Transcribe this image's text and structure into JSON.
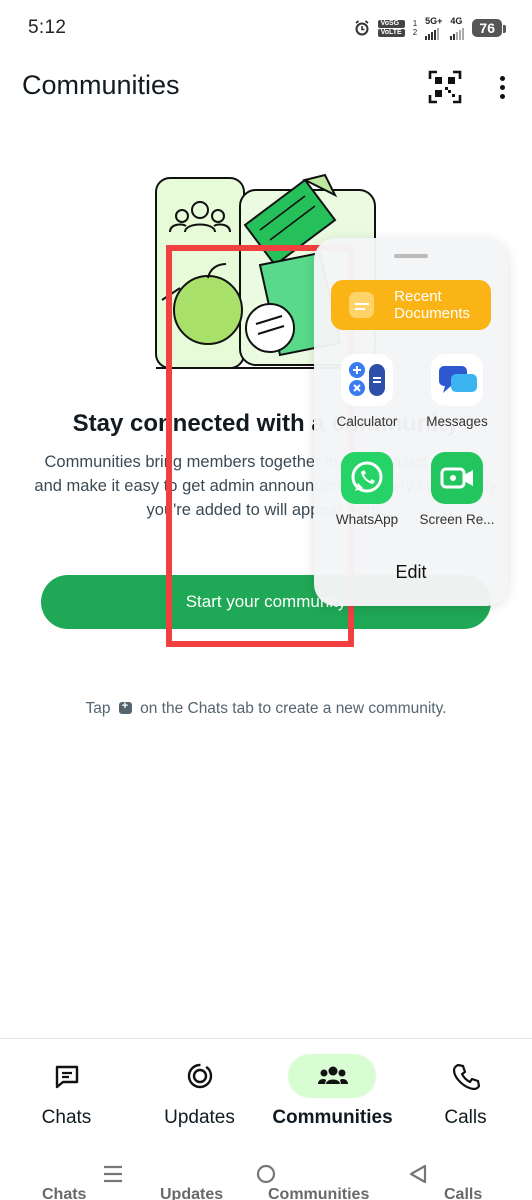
{
  "status_bar": {
    "time": "5:12",
    "volte_top": "VoSG",
    "volte_bottom": "VoLTE",
    "sim1": "1",
    "sim2": "2",
    "net1": "5G+",
    "net2": "4G",
    "battery": "76"
  },
  "header": {
    "title": "Communities",
    "qr_icon": "qr-code-icon",
    "more_icon": "more-vertical-icon"
  },
  "main": {
    "headline": "Stay connected with a community",
    "description": "Communities bring members together in topic-based groups, and make it easy to get admin announcements. Any community you're added to will appear here.",
    "start_button": "Start your community",
    "hint_before": "Tap",
    "hint_after": "on the Chats tab to create a new community."
  },
  "side_panel": {
    "recent_documents": "Recent Documents",
    "apps": [
      {
        "label": "Calculator",
        "icon": "calculator-icon"
      },
      {
        "label": "Messages",
        "icon": "messages-icon"
      },
      {
        "label": "WhatsApp",
        "icon": "whatsapp-icon"
      },
      {
        "label": "Screen Re...",
        "icon": "screen-recorder-icon"
      }
    ],
    "edit": "Edit"
  },
  "bottom_nav": {
    "items": [
      {
        "label": "Chats",
        "icon": "chats-icon",
        "active": false
      },
      {
        "label": "Updates",
        "icon": "updates-icon",
        "active": false
      },
      {
        "label": "Communities",
        "icon": "communities-icon",
        "active": true
      },
      {
        "label": "Calls",
        "icon": "calls-icon",
        "active": false
      }
    ]
  },
  "colors": {
    "accent": "#1fa855",
    "active_pill": "#d8fdd2",
    "highlight": "#f24040",
    "recent_docs": "#fbb415"
  }
}
